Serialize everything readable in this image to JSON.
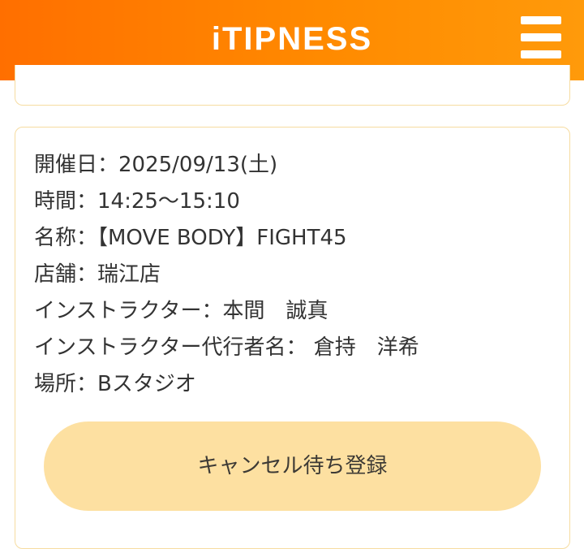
{
  "header": {
    "logo": "iTIPNESS",
    "menu_icon": "hamburger-menu-icon"
  },
  "lesson": {
    "date": "開催日：2025/09/13(土)",
    "time": "時間：14:25〜15:10",
    "name": "名称：【MOVE BODY】FIGHT45",
    "store": "店舗：瑞江店",
    "instructor": "インストラクター：本間　誠真",
    "substitute": "インストラクター代行者名： 倉持　洋希",
    "place": "場所：Bスタジオ"
  },
  "action": {
    "waitlist_label": "キャンセル待ち登録"
  },
  "colors": {
    "header_start": "#ff6f00",
    "header_end": "#ff9a0a",
    "card_border": "#f6dca0",
    "button_bg": "#fde0a1"
  }
}
